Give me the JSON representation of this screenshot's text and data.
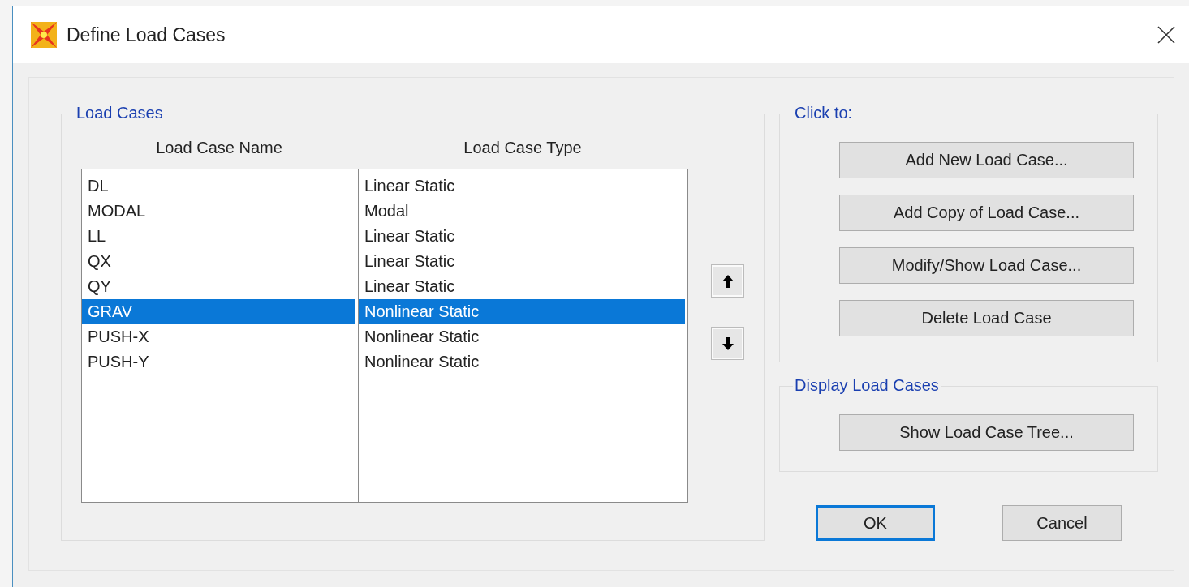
{
  "window": {
    "title": "Define Load Cases"
  },
  "load_cases": {
    "legend": "Load Cases",
    "columns": [
      "Load Case Name",
      "Load Case Type"
    ],
    "rows": [
      {
        "name": "DL",
        "type": "Linear Static",
        "selected": false
      },
      {
        "name": "MODAL",
        "type": "Modal",
        "selected": false
      },
      {
        "name": "LL",
        "type": "Linear Static",
        "selected": false
      },
      {
        "name": "QX",
        "type": "Linear Static",
        "selected": false
      },
      {
        "name": "QY",
        "type": "Linear Static",
        "selected": false
      },
      {
        "name": "GRAV",
        "type": "Nonlinear Static",
        "selected": true
      },
      {
        "name": "PUSH-X",
        "type": "Nonlinear Static",
        "selected": false
      },
      {
        "name": "PUSH-Y",
        "type": "Nonlinear Static",
        "selected": false
      }
    ]
  },
  "click_to": {
    "legend": "Click to:",
    "buttons": [
      "Add New Load Case...",
      "Add Copy of Load Case...",
      "Modify/Show Load Case...",
      "Delete Load Case"
    ]
  },
  "display": {
    "legend": "Display Load Cases",
    "buttons": [
      "Show Load Case Tree..."
    ]
  },
  "dialog_buttons": [
    {
      "label": "OK",
      "focused": true
    },
    {
      "label": "Cancel",
      "focused": false
    }
  ]
}
